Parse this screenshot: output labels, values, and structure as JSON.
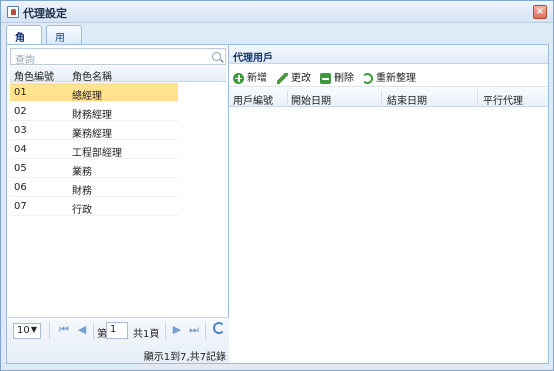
{
  "window": {
    "title": "代理設定",
    "close_label": "×"
  },
  "tabs": [
    {
      "label": "角色"
    },
    {
      "label": "用戶"
    }
  ],
  "left": {
    "search_placeholder": "查詢",
    "columns": [
      "角色編號",
      "角色名稱"
    ],
    "rows": [
      {
        "code": "01",
        "name": "總經理"
      },
      {
        "code": "02",
        "name": "財務經理"
      },
      {
        "code": "03",
        "name": "業務經理"
      },
      {
        "code": "04",
        "name": "工程部經理"
      },
      {
        "code": "05",
        "name": "業務"
      },
      {
        "code": "06",
        "name": "財務"
      },
      {
        "code": "07",
        "name": "行政"
      }
    ],
    "pager": {
      "page_size": "10",
      "page_prefix": "第",
      "page_value": "1",
      "page_suffix": "共1頁",
      "info": "顯示1到7,共7記錄"
    }
  },
  "right": {
    "title": "代理用戶",
    "toolbar": [
      "新增",
      "更改",
      "刪除",
      "重新整理"
    ],
    "columns": [
      "用戶編號",
      "開始日期",
      "結束日期",
      "平行代理"
    ]
  }
}
